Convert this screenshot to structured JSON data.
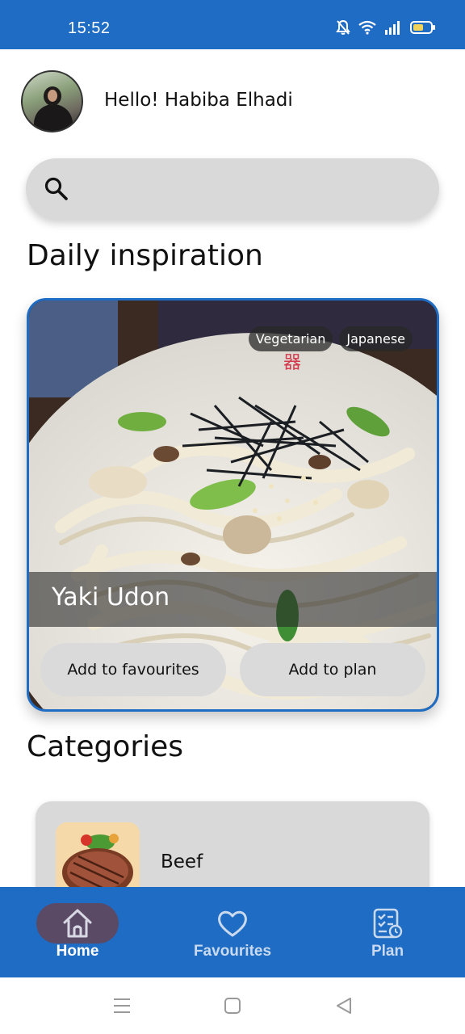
{
  "status_bar": {
    "time": "15:52",
    "icons": [
      "bell-off-icon",
      "wifi-icon",
      "signal-icon",
      "battery-icon"
    ]
  },
  "header": {
    "greeting": "Hello! Habiba Elhadi"
  },
  "search": {
    "placeholder": "",
    "value": ""
  },
  "daily": {
    "title": "Daily inspiration",
    "meal": {
      "name": "Yaki Udon",
      "tags": [
        "Vegetarian",
        "Japanese"
      ],
      "add_fav_label": "Add to favourites",
      "add_plan_label": "Add to plan"
    }
  },
  "categories": {
    "title": "Categories",
    "items": [
      {
        "label": "Beef"
      }
    ]
  },
  "bottom_nav": {
    "items": [
      {
        "label": "Home",
        "icon": "home-icon",
        "active": true
      },
      {
        "label": "Favourites",
        "icon": "heart-icon",
        "active": false
      },
      {
        "label": "Plan",
        "icon": "checklist-icon",
        "active": false
      }
    ]
  },
  "colors": {
    "primary": "#1f6cc4",
    "surface_gray": "#d9d9d9",
    "active_pill": "#5a4a66"
  }
}
